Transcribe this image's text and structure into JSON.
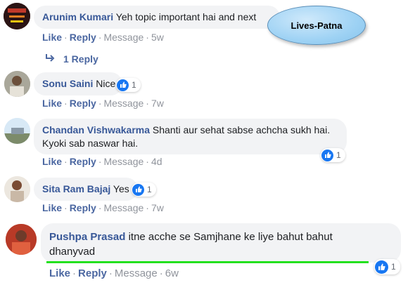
{
  "overlay_tag": "Lives-Patna",
  "comments": [
    {
      "name": "Arunim Kumari",
      "text": "Yeh topic important hai and next",
      "like": "Like",
      "reply": "Reply",
      "message": "Message",
      "time": "5w",
      "replies_label": "1 Reply"
    },
    {
      "name": "Sonu Saini",
      "text": "Nice",
      "reactions": "1",
      "like": "Like",
      "reply": "Reply",
      "message": "Message",
      "time": "7w"
    },
    {
      "name": "Chandan Vishwakarma",
      "text": "Shanti aur sehat sabse achcha sukh hai.",
      "text2": "Kyoki sab naswar hai.",
      "reactions": "1",
      "like": "Like",
      "reply": "Reply",
      "message": "Message",
      "time": "4d"
    },
    {
      "name": "Sita Ram Bajaj",
      "text": "Yes",
      "reactions": "1",
      "like": "Like",
      "reply": "Reply",
      "message": "Message",
      "time": "7w"
    },
    {
      "name": "Pushpa Prasad",
      "text": "itne acche se Samjhane ke liye bahut bahut",
      "text2": "dhanyvad",
      "reactions": "1",
      "like": "Like",
      "reply": "Reply",
      "message": "Message",
      "time": "6w"
    }
  ],
  "colors": {
    "name": "#385898",
    "link": "#4b67a1",
    "meta": "#90949c",
    "bubble": "#f2f3f5",
    "like_blue": "#1877f2",
    "highlight": "#23e11e"
  }
}
